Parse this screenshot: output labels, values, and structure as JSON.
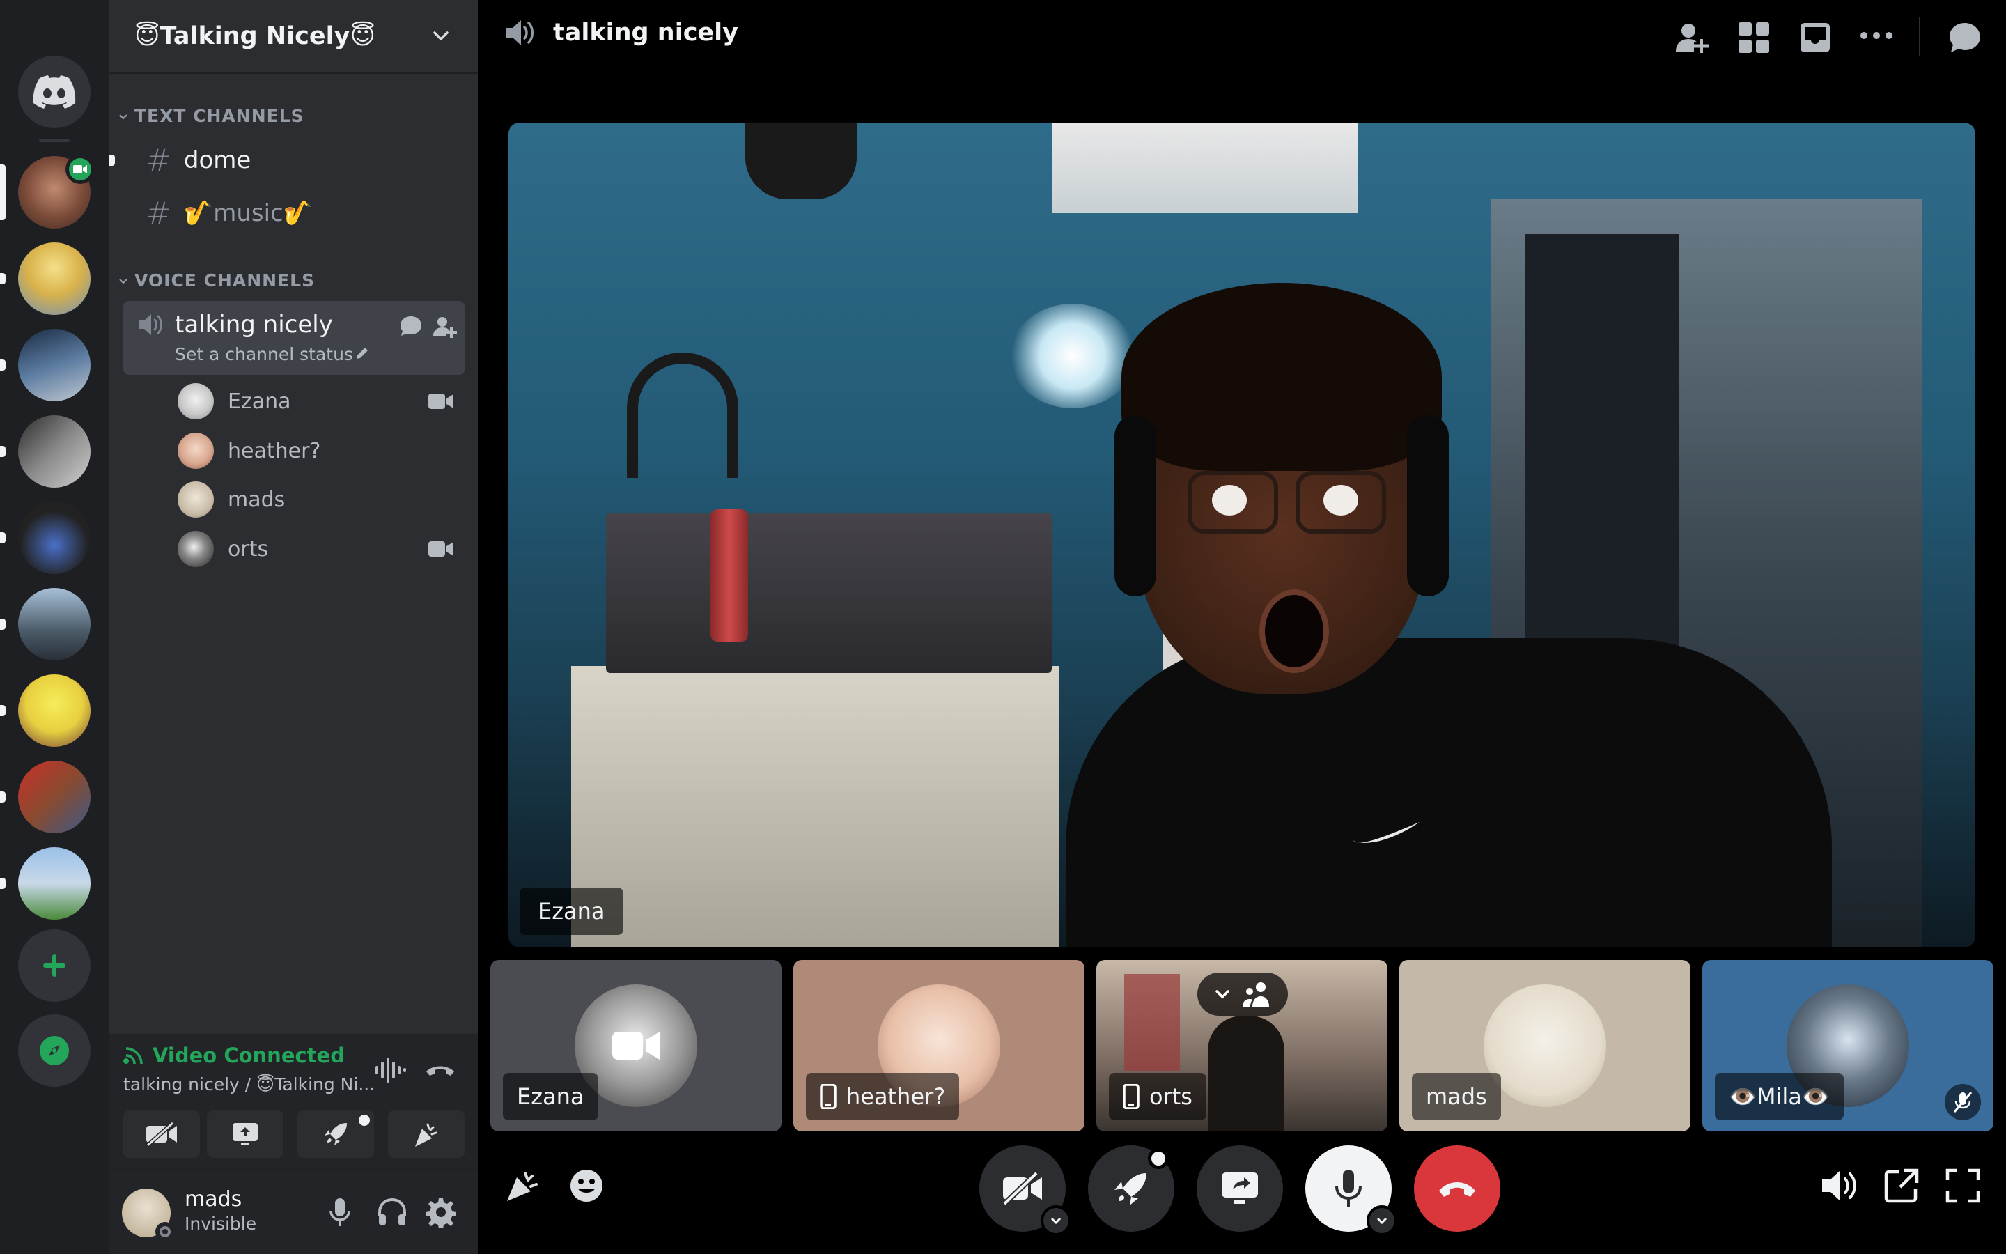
{
  "colors": {
    "rail_bg": "#1e1f22",
    "sidebar_bg": "#2b2d31",
    "accent_green": "#23a55a",
    "danger_red": "#da373c",
    "text_muted": "#949ba4"
  },
  "server": {
    "name": "😇Talking Nicely😇"
  },
  "rail": {
    "icons": [
      "discord-home-icon",
      "add-server-icon",
      "discover-icon"
    ]
  },
  "sidebar": {
    "text_category": "TEXT CHANNELS",
    "text_channels": [
      {
        "name": "dome"
      },
      {
        "name": "🎷music🎷"
      }
    ],
    "voice_category": "VOICE CHANNELS",
    "voice_channel": {
      "name": "talking nicely",
      "status_placeholder": "Set a channel status"
    },
    "members": [
      {
        "name": "Ezana",
        "camera": true
      },
      {
        "name": "heather?",
        "camera": false
      },
      {
        "name": "mads",
        "camera": false
      },
      {
        "name": "orts",
        "camera": true
      }
    ]
  },
  "voice_panel": {
    "status": "Video Connected",
    "location": "talking nicely / 😇Talking Ni..."
  },
  "user": {
    "name": "mads",
    "status": "Invisible"
  },
  "main": {
    "title": "talking nicely",
    "focused_video_label": "Ezana",
    "tiles": [
      {
        "name": "Ezana"
      },
      {
        "name": "heather?"
      },
      {
        "name": "orts"
      },
      {
        "name": "mads"
      },
      {
        "name": "👁️Mila👁️"
      }
    ]
  }
}
